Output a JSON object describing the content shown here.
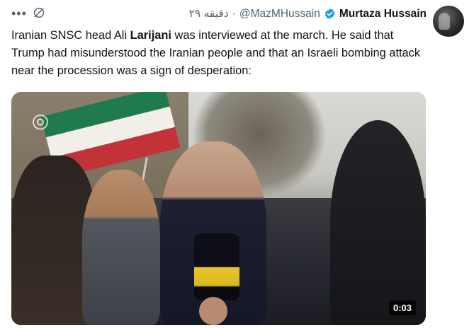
{
  "author": {
    "display_name": "Murtaza Hussain",
    "handle": "@MazMHussain",
    "time": "دقیقه ۲۹",
    "separator": "·"
  },
  "tweet": {
    "text_before": "Iranian SNSC head Ali ",
    "text_bold": "Larijani",
    "text_after": " was interviewed at the march. He said that Trump had misunderstood the Iranian people and that an Israeli bombing attack near the procession was a sign of desperation:"
  },
  "media": {
    "duration": "0:03",
    "channel_logo_icon": "broadcast-logo-icon"
  },
  "icons": {
    "more": "more-icon",
    "grok": "grok-icon",
    "verified": "verified-badge-icon"
  },
  "colors": {
    "verified": "#1d9bf0",
    "secondary_text": "#536471",
    "primary_text": "#0f1419"
  }
}
